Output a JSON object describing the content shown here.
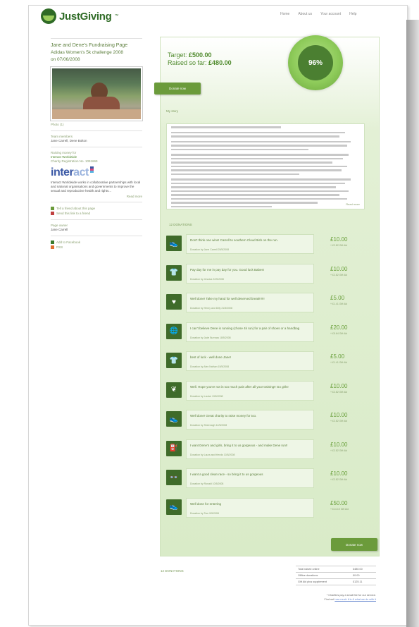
{
  "header": {
    "logo_text": "JustGiving",
    "logo_tm": "™",
    "nav": [
      "Home",
      "About us",
      "Your account",
      "Help"
    ]
  },
  "sidebar": {
    "title": "Jane and Dene's Fundraising Page",
    "event": "Adidas Women's 5k challenge 2008",
    "event_date": "on 07/06/2008",
    "photo_link": "Photo (1)",
    "team_label": "Team members",
    "team_value": "Jane Carrell, Dene Bolton",
    "raising_label": "Raising money for",
    "charity_name": "Interact Worldwide",
    "charity_reg": "Charity Registration No. 1091669",
    "charity_logo_main": "inter",
    "charity_logo_accent": "act",
    "charity_desc": "Interact Worldwide works in collaborative partnerships with local and national organisations and governments to improve the sexual and reproductive health and rights...",
    "read_more": "Read more",
    "links": [
      "Tell a friend about this page",
      "Send this link to a friend"
    ],
    "page_owner_label": "Page owner",
    "page_owner_value": "Jane Carrell",
    "share": [
      "Add to Facebook",
      "RSS"
    ]
  },
  "summary": {
    "target_label": "Target:",
    "target_value": "£500.00",
    "raised_label": "Raised so far:",
    "raised_value": "£480.00",
    "percent": "96%",
    "percent_fraction": 0.96,
    "donate_label": "Donate now"
  },
  "story": {
    "heading": "My story",
    "line_count": 20,
    "read_more": "Read more"
  },
  "messages_heading": "12 DONATIONS",
  "donations": [
    {
      "icon": "shoe",
      "glyph": "👟",
      "message": "Don't think one wins! Carrell to southern Cloud 9ish on the run.",
      "by": "Donation by Jane Carrell 25/5/2008",
      "amount": "£10.00",
      "gift_aid": "+ £2.82 Gift Aid"
    },
    {
      "icon": "shirt",
      "glyph": "👕",
      "message": "Pay day for me in pay day for you. Good luck Babes!",
      "by": "Donation by Jessica 22/5/2008",
      "amount": "£10.00",
      "gift_aid": "+ £2.82 Gift Aid"
    },
    {
      "icon": "heart",
      "glyph": "♥",
      "message": "Well done! Take my hand for well deserved break!!!!!!",
      "by": "Donation by Henry and Dilly 21/5/2008",
      "amount": "£5.00",
      "gift_aid": "+ £1.41 Gift Aid"
    },
    {
      "icon": "globe",
      "glyph": "🌐",
      "message": "I can't believe Dene is running (chose 4k run) for a pair of shoes or a handbag",
      "by": "Donation by Jade Burrows 18/5/2008",
      "amount": "£20.00",
      "gift_aid": "+ £5.64 Gift Aid"
    },
    {
      "icon": "shirt",
      "glyph": "👕",
      "message": "best of luck - well done Jane!",
      "by": "Donation by Alex Nathan 15/5/2008",
      "amount": "£5.00",
      "gift_aid": "+ £1.41 Gift Aid"
    },
    {
      "icon": "plant",
      "glyph": "❦",
      "message": "Well. Hope you're not in too much pain after all your training!! Go girls!",
      "by": "Donation by Louise 13/5/2008",
      "amount": "£10.00",
      "gift_aid": "+ £2.82 Gift Aid"
    },
    {
      "icon": "shoe",
      "glyph": "👟",
      "message": "Well done! Great charity to raise money for too.",
      "by": "Donation by Sheenagh 12/5/2008",
      "amount": "£10.00",
      "gift_aid": "+ £2.82 Gift Aid"
    },
    {
      "icon": "fuel",
      "glyph": "⛽",
      "message": "I want Dene's and girls, bring it to us gorgeous - and make Dene run!!",
      "by": "Donation by Laura and friends 10/5/2008",
      "amount": "£10.00",
      "gift_aid": "+ £2.82 Gift Aid"
    },
    {
      "icon": "glasses",
      "glyph": "👓",
      "message": "I want a good clean race - so bring it to us gorgeous",
      "by": "Donation by Ronald 10/5/2008",
      "amount": "£10.00",
      "gift_aid": "+ £2.82 Gift Aid"
    },
    {
      "icon": "shoe",
      "glyph": "👟",
      "message": "Well done for entering",
      "by": "Donation by Tom 9/5/2008",
      "amount": "£50.00",
      "gift_aid": "+ £14.10 Gift Aid"
    }
  ],
  "donate_bottom": "Donate now",
  "footer": {
    "count": "12 DONATIONS",
    "totals": [
      {
        "label": "Total raised online",
        "value": "£480.00"
      },
      {
        "label": "Offline donations",
        "value": "£0.00"
      },
      {
        "label": "Gift Aid plus supplement",
        "value": "£125.11"
      }
    ],
    "note_line1": "* Charities pay a small fee for our service.",
    "note_line2_prefix": "Find out ",
    "note_line2_link": "how much it is & what we do with it"
  }
}
